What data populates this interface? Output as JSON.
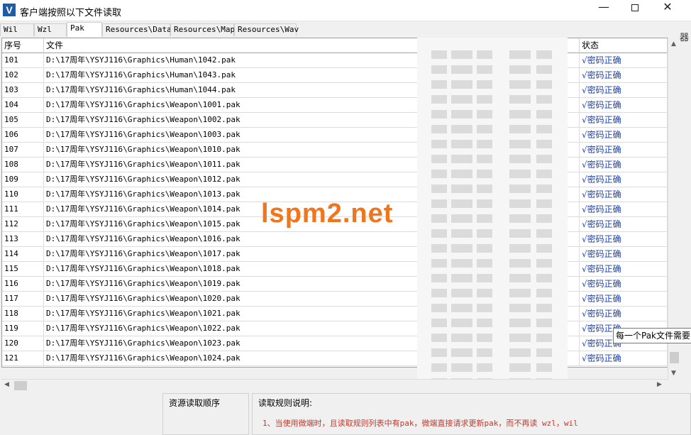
{
  "window": {
    "title": "客户端按照以下文件读取",
    "min_glyph": "—",
    "close_glyph": "✕"
  },
  "tabs": [
    {
      "label": "Wil"
    },
    {
      "label": "Wzl"
    },
    {
      "label": "Pak",
      "active": true
    },
    {
      "label": "Resources\\Data"
    },
    {
      "label": "Resources\\Map"
    },
    {
      "label": "Resources\\Wav"
    }
  ],
  "side_text": "器",
  "grid": {
    "headers": {
      "no": "序号",
      "file": "文件",
      "status": "状态"
    },
    "rows": [
      {
        "no": "101",
        "file": "D:\\17周年\\YSYJ116\\Graphics\\Human\\1042.pak",
        "status": "√密码正确"
      },
      {
        "no": "102",
        "file": "D:\\17周年\\YSYJ116\\Graphics\\Human\\1043.pak",
        "status": "√密码正确"
      },
      {
        "no": "103",
        "file": "D:\\17周年\\YSYJ116\\Graphics\\Human\\1044.pak",
        "status": "√密码正确"
      },
      {
        "no": "104",
        "file": "D:\\17周年\\YSYJ116\\Graphics\\Weapon\\1001.pak",
        "status": "√密码正确"
      },
      {
        "no": "105",
        "file": "D:\\17周年\\YSYJ116\\Graphics\\Weapon\\1002.pak",
        "status": "√密码正确"
      },
      {
        "no": "106",
        "file": "D:\\17周年\\YSYJ116\\Graphics\\Weapon\\1003.pak",
        "status": "√密码正确"
      },
      {
        "no": "107",
        "file": "D:\\17周年\\YSYJ116\\Graphics\\Weapon\\1010.pak",
        "status": "√密码正确"
      },
      {
        "no": "108",
        "file": "D:\\17周年\\YSYJ116\\Graphics\\Weapon\\1011.pak",
        "status": "√密码正确"
      },
      {
        "no": "109",
        "file": "D:\\17周年\\YSYJ116\\Graphics\\Weapon\\1012.pak",
        "status": "√密码正确"
      },
      {
        "no": "110",
        "file": "D:\\17周年\\YSYJ116\\Graphics\\Weapon\\1013.pak",
        "status": "√密码正确"
      },
      {
        "no": "111",
        "file": "D:\\17周年\\YSYJ116\\Graphics\\Weapon\\1014.pak",
        "status": "√密码正确"
      },
      {
        "no": "112",
        "file": "D:\\17周年\\YSYJ116\\Graphics\\Weapon\\1015.pak",
        "status": "√密码正确"
      },
      {
        "no": "113",
        "file": "D:\\17周年\\YSYJ116\\Graphics\\Weapon\\1016.pak",
        "status": "√密码正确"
      },
      {
        "no": "114",
        "file": "D:\\17周年\\YSYJ116\\Graphics\\Weapon\\1017.pak",
        "status": "√密码正确"
      },
      {
        "no": "115",
        "file": "D:\\17周年\\YSYJ116\\Graphics\\Weapon\\1018.pak",
        "status": "√密码正确"
      },
      {
        "no": "116",
        "file": "D:\\17周年\\YSYJ116\\Graphics\\Weapon\\1019.pak",
        "status": "√密码正确"
      },
      {
        "no": "117",
        "file": "D:\\17周年\\YSYJ116\\Graphics\\Weapon\\1020.pak",
        "status": "√密码正确"
      },
      {
        "no": "118",
        "file": "D:\\17周年\\YSYJ116\\Graphics\\Weapon\\1021.pak",
        "status": "√密码正确"
      },
      {
        "no": "119",
        "file": "D:\\17周年\\YSYJ116\\Graphics\\Weapon\\1022.pak",
        "status": "√密码正确"
      },
      {
        "no": "120",
        "file": "D:\\17周年\\YSYJ116\\Graphics\\Weapon\\1023.pak",
        "status": "√密码正确"
      },
      {
        "no": "121",
        "file": "D:\\17周年\\YSYJ116\\Graphics\\Weapon\\1024.pak",
        "status": "√密码正确"
      }
    ]
  },
  "tooltip": "每一个Pak文件需要",
  "watermark": "lspm2.net",
  "bottom": {
    "order_title": "资源读取顺序",
    "rules_title": "读取规则说明:",
    "rule_1": "1、当使用微端时，且读取规则列表中有pak，微端直接请求更新pak，而不再读 wzl，wil"
  },
  "colors": {
    "status_text": "#1a3fb5",
    "rule_text": "#c0392b",
    "watermark": "#f0761e"
  }
}
